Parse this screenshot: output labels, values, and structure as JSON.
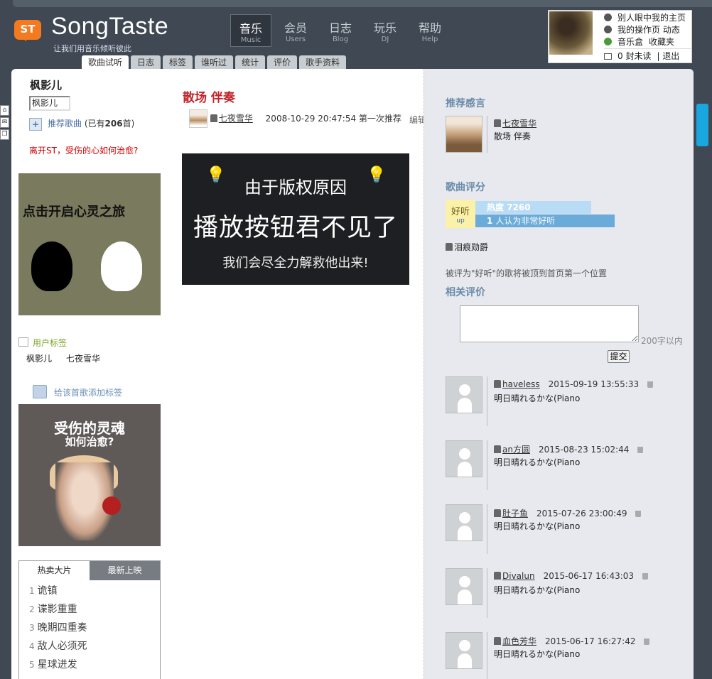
{
  "header": {
    "logo_text": "ST",
    "brand": "SongTaste",
    "slogan": "让我们用音乐倾听彼此",
    "nav": [
      {
        "cn": "音乐",
        "en": "Music"
      },
      {
        "cn": "会员",
        "en": "Users"
      },
      {
        "cn": "日志",
        "en": "Blog"
      },
      {
        "cn": "玩乐",
        "en": "DJ"
      },
      {
        "cn": "帮助",
        "en": "Help"
      }
    ],
    "tabs": [
      "歌曲试听",
      "日志",
      "标签",
      "谁听过",
      "统计",
      "评价",
      "歌手资料"
    ]
  },
  "userbox": {
    "line1": "别人眼中我的主页",
    "line2": "我的操作页 动态",
    "line3a": "音乐盒",
    "line3b": "收藏夹",
    "line4a": "0 封未读",
    "line4b": "| 退出"
  },
  "left": {
    "username": "枫影儿",
    "avatar_alt": "枫影儿",
    "recommend_link": "推荐歌曲",
    "recommend_count_prefix": "(已有",
    "recommend_count": "206",
    "recommend_count_suffix": "首)",
    "leave_text": "离开ST，受伤的心如何治愈?",
    "ad1_text": "点击开启心灵之旅",
    "user_tags_title": "用户标签",
    "tags": [
      "枫影儿",
      "七夜雪华"
    ],
    "add_tag_link": "给该首歌添加标签",
    "ad2_line1": "受伤的灵魂",
    "ad2_line2": "如何治愈?",
    "hot_tabs": [
      "热卖大片",
      "最新上映"
    ],
    "hot_list": [
      {
        "n": "1",
        "t": "诡镇"
      },
      {
        "n": "2",
        "t": "谍影重重"
      },
      {
        "n": "3",
        "t": "晚期四重奏"
      },
      {
        "n": "4",
        "t": "敌人必须死"
      },
      {
        "n": "5",
        "t": "星球进发"
      }
    ]
  },
  "center": {
    "song_title": "散场 伴奏",
    "recommender": "七夜雪华",
    "rec_date": "2008-10-29 20:47:54 第一次推荐",
    "edit": "编辑",
    "copyright_line1": "由于版权原因",
    "copyright_line2": "播放按钮君不见了",
    "copyright_line3": "我们会尽全力解救他出来!"
  },
  "right": {
    "rec_title": "推荐感言",
    "rec_by": "七夜雪华",
    "rec_text": "散场 伴奏",
    "rating_title": "歌曲评分",
    "good_label": "好听",
    "up_label": "up",
    "heat_label": "热度",
    "heat_value": "7260",
    "vote_count": "1",
    "vote_text": "人认为非常好听",
    "voter": "泪痕勋爵",
    "note": "被评为\"好听\"的歌将被顶到首页第一个位置",
    "related_title": "相关评价",
    "limit": "200字以内",
    "submit": "提交",
    "comments": [
      {
        "user": "haveless",
        "date": "2015-09-19 13:55:33",
        "text": "明日晴れるかな(Piano"
      },
      {
        "user": "an方圆",
        "date": "2015-08-23 15:02:44",
        "text": "明日晴れるかな(Piano"
      },
      {
        "user": "肚子鱼",
        "date": "2015-07-26 23:00:49",
        "text": "明日晴れるかな(Piano"
      },
      {
        "user": "Divalun",
        "date": "2015-06-17 16:43:03",
        "text": "明日晴れるかな(Piano"
      },
      {
        "user": "血色芳华",
        "date": "2015-06-17 16:27:42",
        "text": "明日晴れるかな(Piano"
      }
    ]
  },
  "colors": {
    "accent_orange": "#f47a20",
    "title_red": "#c0252c",
    "section_blue": "#6a8aa8",
    "heat_bar": "#6aabd9"
  },
  "icons": [
    "home-icon",
    "mail-icon",
    "copy-icon",
    "plus-icon",
    "tag-icon",
    "user-icon",
    "trash-icon",
    "bulb-icon"
  ]
}
